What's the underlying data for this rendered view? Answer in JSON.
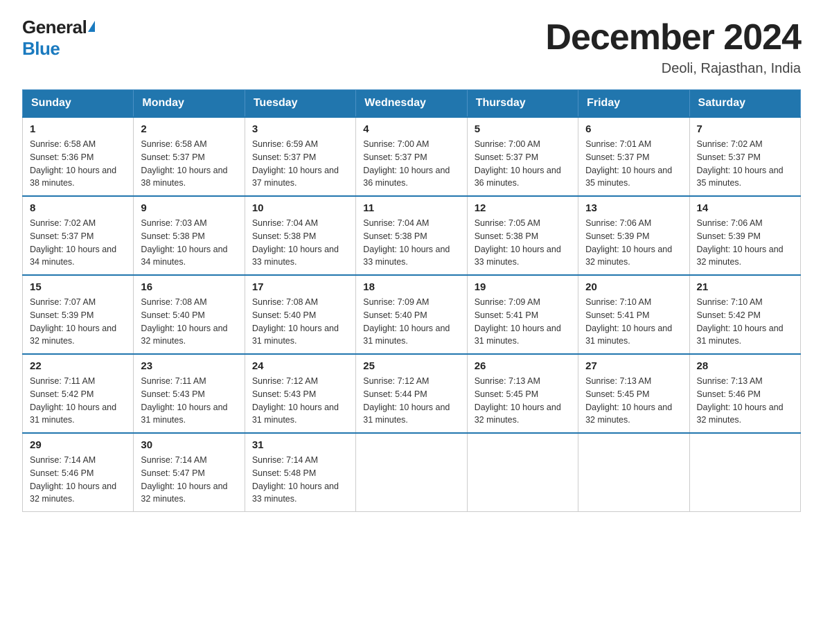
{
  "header": {
    "logo_general": "General",
    "logo_blue": "Blue",
    "calendar_title": "December 2024",
    "calendar_subtitle": "Deoli, Rajasthan, India"
  },
  "days_of_week": [
    "Sunday",
    "Monday",
    "Tuesday",
    "Wednesday",
    "Thursday",
    "Friday",
    "Saturday"
  ],
  "weeks": [
    [
      {
        "day": "1",
        "sunrise": "6:58 AM",
        "sunset": "5:36 PM",
        "daylight": "10 hours and 38 minutes."
      },
      {
        "day": "2",
        "sunrise": "6:58 AM",
        "sunset": "5:37 PM",
        "daylight": "10 hours and 38 minutes."
      },
      {
        "day": "3",
        "sunrise": "6:59 AM",
        "sunset": "5:37 PM",
        "daylight": "10 hours and 37 minutes."
      },
      {
        "day": "4",
        "sunrise": "7:00 AM",
        "sunset": "5:37 PM",
        "daylight": "10 hours and 36 minutes."
      },
      {
        "day": "5",
        "sunrise": "7:00 AM",
        "sunset": "5:37 PM",
        "daylight": "10 hours and 36 minutes."
      },
      {
        "day": "6",
        "sunrise": "7:01 AM",
        "sunset": "5:37 PM",
        "daylight": "10 hours and 35 minutes."
      },
      {
        "day": "7",
        "sunrise": "7:02 AM",
        "sunset": "5:37 PM",
        "daylight": "10 hours and 35 minutes."
      }
    ],
    [
      {
        "day": "8",
        "sunrise": "7:02 AM",
        "sunset": "5:37 PM",
        "daylight": "10 hours and 34 minutes."
      },
      {
        "day": "9",
        "sunrise": "7:03 AM",
        "sunset": "5:38 PM",
        "daylight": "10 hours and 34 minutes."
      },
      {
        "day": "10",
        "sunrise": "7:04 AM",
        "sunset": "5:38 PM",
        "daylight": "10 hours and 33 minutes."
      },
      {
        "day": "11",
        "sunrise": "7:04 AM",
        "sunset": "5:38 PM",
        "daylight": "10 hours and 33 minutes."
      },
      {
        "day": "12",
        "sunrise": "7:05 AM",
        "sunset": "5:38 PM",
        "daylight": "10 hours and 33 minutes."
      },
      {
        "day": "13",
        "sunrise": "7:06 AM",
        "sunset": "5:39 PM",
        "daylight": "10 hours and 32 minutes."
      },
      {
        "day": "14",
        "sunrise": "7:06 AM",
        "sunset": "5:39 PM",
        "daylight": "10 hours and 32 minutes."
      }
    ],
    [
      {
        "day": "15",
        "sunrise": "7:07 AM",
        "sunset": "5:39 PM",
        "daylight": "10 hours and 32 minutes."
      },
      {
        "day": "16",
        "sunrise": "7:08 AM",
        "sunset": "5:40 PM",
        "daylight": "10 hours and 32 minutes."
      },
      {
        "day": "17",
        "sunrise": "7:08 AM",
        "sunset": "5:40 PM",
        "daylight": "10 hours and 31 minutes."
      },
      {
        "day": "18",
        "sunrise": "7:09 AM",
        "sunset": "5:40 PM",
        "daylight": "10 hours and 31 minutes."
      },
      {
        "day": "19",
        "sunrise": "7:09 AM",
        "sunset": "5:41 PM",
        "daylight": "10 hours and 31 minutes."
      },
      {
        "day": "20",
        "sunrise": "7:10 AM",
        "sunset": "5:41 PM",
        "daylight": "10 hours and 31 minutes."
      },
      {
        "day": "21",
        "sunrise": "7:10 AM",
        "sunset": "5:42 PM",
        "daylight": "10 hours and 31 minutes."
      }
    ],
    [
      {
        "day": "22",
        "sunrise": "7:11 AM",
        "sunset": "5:42 PM",
        "daylight": "10 hours and 31 minutes."
      },
      {
        "day": "23",
        "sunrise": "7:11 AM",
        "sunset": "5:43 PM",
        "daylight": "10 hours and 31 minutes."
      },
      {
        "day": "24",
        "sunrise": "7:12 AM",
        "sunset": "5:43 PM",
        "daylight": "10 hours and 31 minutes."
      },
      {
        "day": "25",
        "sunrise": "7:12 AM",
        "sunset": "5:44 PM",
        "daylight": "10 hours and 31 minutes."
      },
      {
        "day": "26",
        "sunrise": "7:13 AM",
        "sunset": "5:45 PM",
        "daylight": "10 hours and 32 minutes."
      },
      {
        "day": "27",
        "sunrise": "7:13 AM",
        "sunset": "5:45 PM",
        "daylight": "10 hours and 32 minutes."
      },
      {
        "day": "28",
        "sunrise": "7:13 AM",
        "sunset": "5:46 PM",
        "daylight": "10 hours and 32 minutes."
      }
    ],
    [
      {
        "day": "29",
        "sunrise": "7:14 AM",
        "sunset": "5:46 PM",
        "daylight": "10 hours and 32 minutes."
      },
      {
        "day": "30",
        "sunrise": "7:14 AM",
        "sunset": "5:47 PM",
        "daylight": "10 hours and 32 minutes."
      },
      {
        "day": "31",
        "sunrise": "7:14 AM",
        "sunset": "5:48 PM",
        "daylight": "10 hours and 33 minutes."
      },
      null,
      null,
      null,
      null
    ]
  ]
}
